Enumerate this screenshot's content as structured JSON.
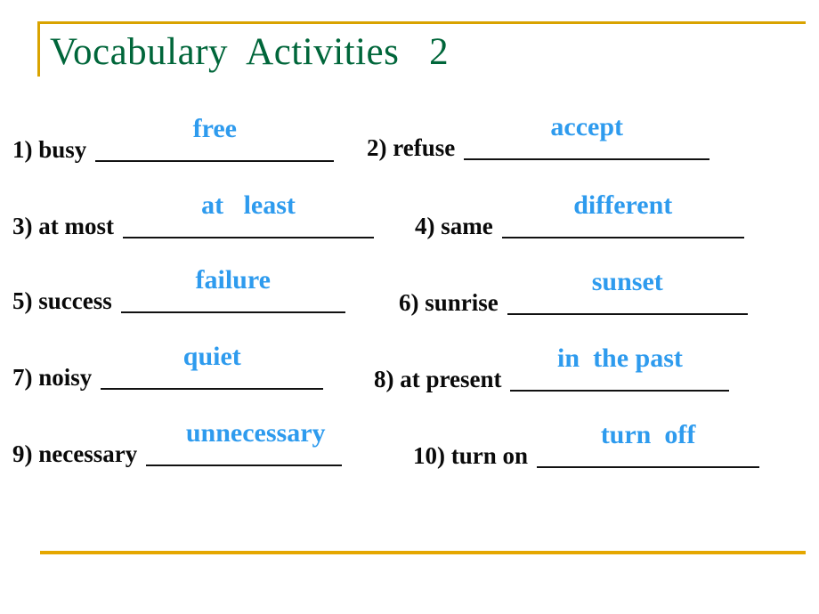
{
  "slide": {
    "title": "Vocabulary  Activities   2",
    "colors": {
      "title_green": "#00663A",
      "rule_gold": "#D9A300",
      "answer_blue": "#2E9BEE",
      "label_black": "#0a0a0a",
      "background": "#ffffff"
    }
  },
  "exercise": {
    "items": [
      {
        "label": "1) busy",
        "answer": "free"
      },
      {
        "label": "2) refuse",
        "answer": "accept"
      },
      {
        "label": "3) at most",
        "answer": "at   least"
      },
      {
        "label": "4) same",
        "answer": "different"
      },
      {
        "label": "5) success",
        "answer": "failure"
      },
      {
        "label": "6) sunrise",
        "answer": "sunset"
      },
      {
        "label": "7) noisy",
        "answer": "quiet"
      },
      {
        "label": "8) at present",
        "answer": "in  the past"
      },
      {
        "label": "9) necessary",
        "answer": "unnecessary"
      },
      {
        "label": "10) turn on",
        "answer": "turn  off"
      }
    ]
  }
}
